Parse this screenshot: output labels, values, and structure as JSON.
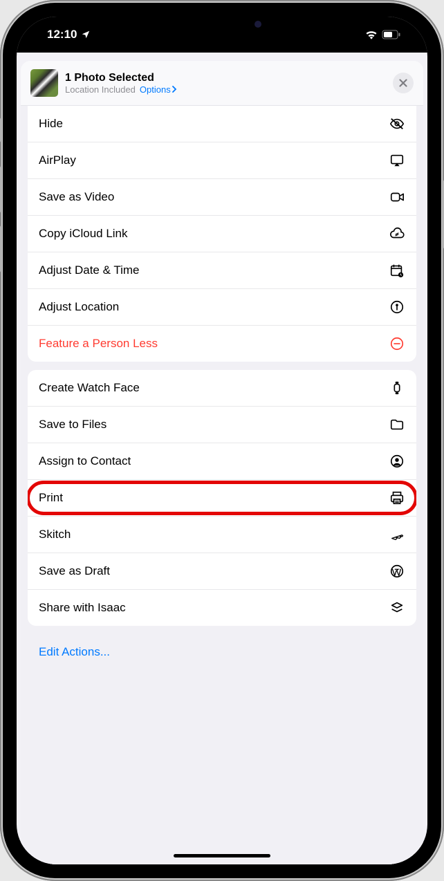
{
  "status": {
    "time": "12:10",
    "location_arrow": "↿",
    "wifi": true,
    "battery": 60
  },
  "header": {
    "title": "1 Photo Selected",
    "subtitle": "Location Included",
    "options_label": "Options"
  },
  "sections": [
    {
      "rows": [
        {
          "label": "Hide",
          "icon": "eye-slash",
          "danger": false,
          "highlighted": false
        },
        {
          "label": "AirPlay",
          "icon": "airplay",
          "danger": false,
          "highlighted": false
        },
        {
          "label": "Save as Video",
          "icon": "video",
          "danger": false,
          "highlighted": false
        },
        {
          "label": "Copy iCloud Link",
          "icon": "cloud-link",
          "danger": false,
          "highlighted": false
        },
        {
          "label": "Adjust Date & Time",
          "icon": "calendar-clock",
          "danger": false,
          "highlighted": false
        },
        {
          "label": "Adjust Location",
          "icon": "pin-circle",
          "danger": false,
          "highlighted": false
        },
        {
          "label": "Feature a Person Less",
          "icon": "minus-circle",
          "danger": true,
          "highlighted": false
        }
      ]
    },
    {
      "rows": [
        {
          "label": "Create Watch Face",
          "icon": "watch",
          "danger": false,
          "highlighted": false
        },
        {
          "label": "Save to Files",
          "icon": "folder",
          "danger": false,
          "highlighted": false
        },
        {
          "label": "Assign to Contact",
          "icon": "contact-circle",
          "danger": false,
          "highlighted": false
        },
        {
          "label": "Print",
          "icon": "printer",
          "danger": false,
          "highlighted": true
        },
        {
          "label": "Skitch",
          "icon": "feather",
          "danger": false,
          "highlighted": false
        },
        {
          "label": "Save as Draft",
          "icon": "wordpress",
          "danger": false,
          "highlighted": false
        },
        {
          "label": "Share with Isaac",
          "icon": "stack",
          "danger": false,
          "highlighted": false
        }
      ]
    }
  ],
  "footer": {
    "edit_actions_label": "Edit Actions..."
  },
  "colors": {
    "accent": "#007aff",
    "danger": "#ff3b30",
    "highlight_ring": "#e30605"
  }
}
